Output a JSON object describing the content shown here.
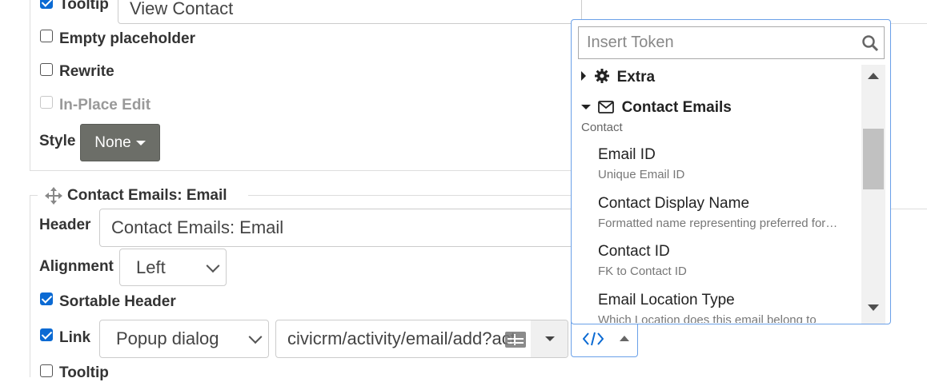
{
  "top_section": {
    "tooltip": {
      "label": "Tooltip",
      "checked": true,
      "value": "View Contact"
    },
    "empty_placeholder": {
      "label": "Empty placeholder",
      "checked": false
    },
    "rewrite": {
      "label": "Rewrite",
      "checked": false
    },
    "in_place_edit": {
      "label": "In-Place Edit",
      "checked": false,
      "disabled": true
    },
    "style": {
      "label": "Style",
      "value": "None"
    }
  },
  "column": {
    "title": "Contact Emails: Email",
    "header": {
      "label": "Header",
      "value": "Contact Emails: Email"
    },
    "alignment": {
      "label": "Alignment",
      "value": "Left"
    },
    "sortable_header": {
      "label": "Sortable Header",
      "checked": true
    },
    "link": {
      "label": "Link",
      "checked": true,
      "type": "Popup dialog",
      "path": "civicrm/activity/email/add?act"
    },
    "tooltip": {
      "label": "Tooltip",
      "checked": false
    }
  },
  "token_picker": {
    "search_placeholder": "Insert Token",
    "groups": [
      {
        "label": "Extra",
        "expanded": false,
        "icon": "gear-icon"
      },
      {
        "label": "Contact Emails",
        "expanded": true,
        "icon": "envelope-icon",
        "subtitle": "Contact"
      }
    ],
    "items": [
      {
        "label": "Email ID",
        "description": "Unique Email ID"
      },
      {
        "label": "Contact Display Name",
        "description": "Formatted name representing preferred for…"
      },
      {
        "label": "Contact ID",
        "description": "FK to Contact ID"
      },
      {
        "label": "Email Location Type",
        "description": "Which Location does this email belong to"
      }
    ]
  },
  "colors": {
    "accent": "#0b6ad3",
    "style_button": "#6c6e68",
    "panel_border": "#6aa0e8"
  }
}
